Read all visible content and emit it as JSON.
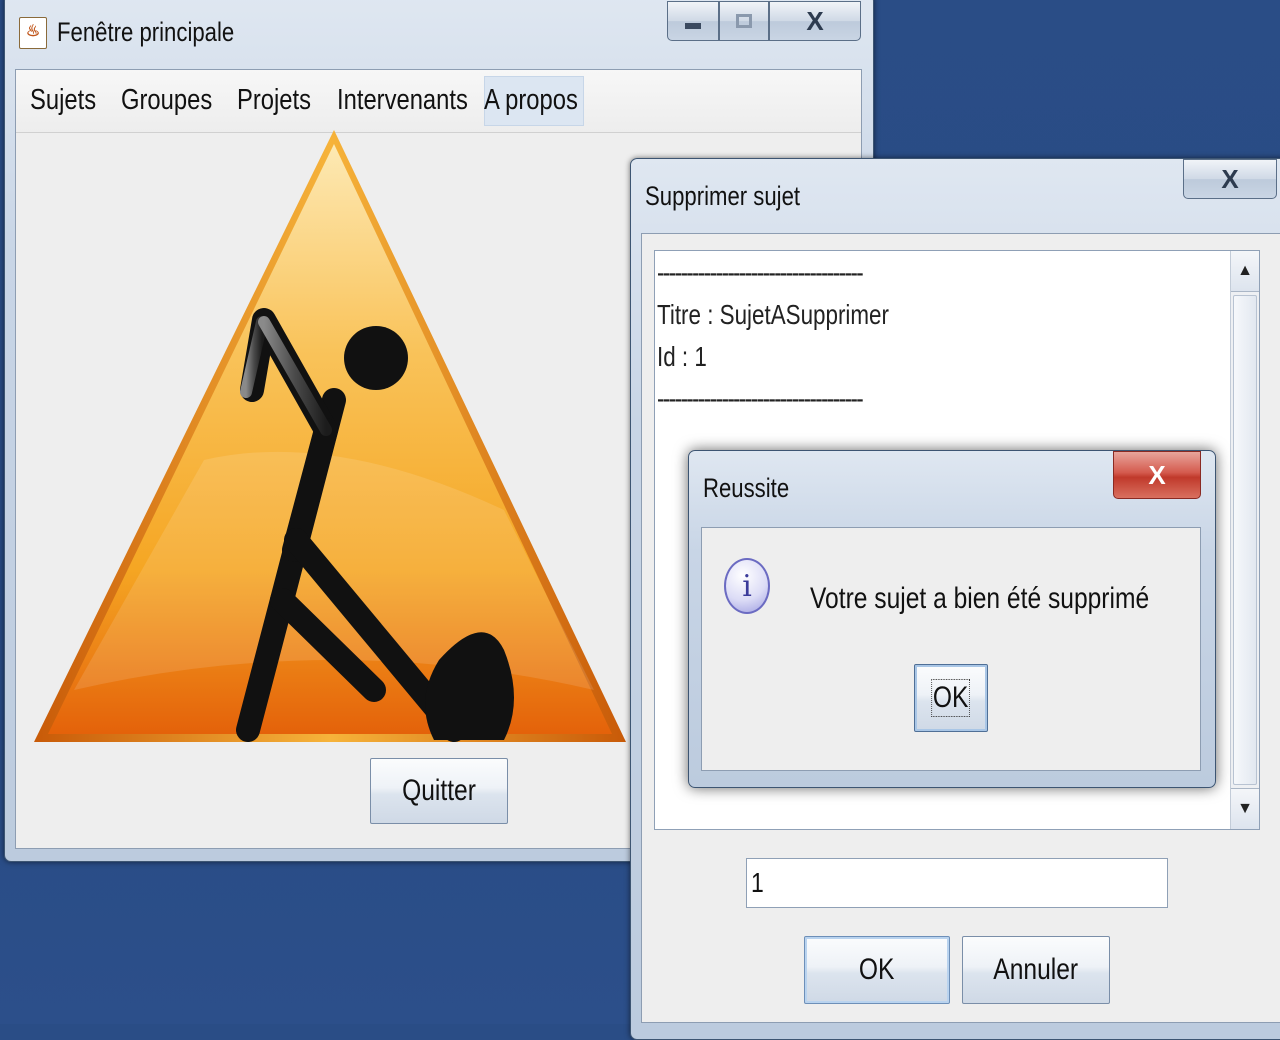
{
  "main_window": {
    "title": "Fenêtre principale",
    "controls": {
      "minimize": "▁",
      "maximize": "☐",
      "close": "X"
    },
    "menu": [
      "Sujets",
      "Groupes",
      "Projets",
      "Intervenants",
      "A propos"
    ],
    "quit_button": "Quitter"
  },
  "delete_dialog": {
    "title": "Supprimer sujet",
    "close": "X",
    "output_lines": [
      "-----------------------------------",
      "Titre : SujetASupprimer",
      "Id : 1",
      "-----------------------------------"
    ],
    "id_input_value": "1",
    "ok_button": "OK",
    "cancel_button": "Annuler"
  },
  "success_dialog": {
    "title": "Reussite",
    "close": "X",
    "message": "Votre sujet a bien été supprimé",
    "info_icon_glyph": "i",
    "ok_button": "OK"
  },
  "colors": {
    "desktop": "#274a83",
    "sign_orange": "#f5a623",
    "close_red": "#c9433a"
  }
}
